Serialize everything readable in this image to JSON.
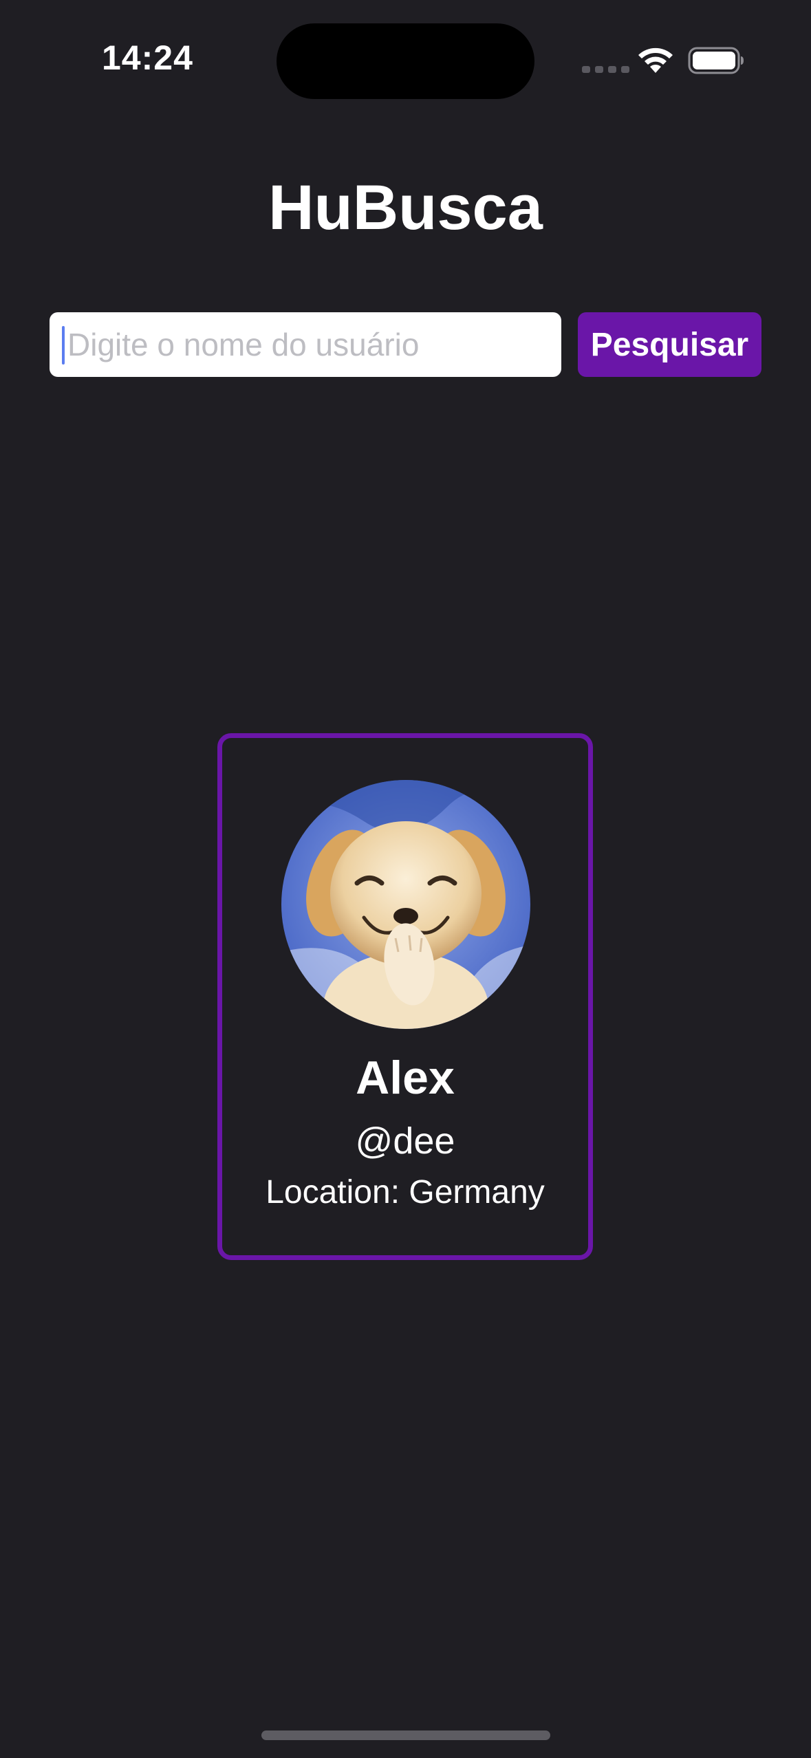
{
  "status_bar": {
    "time": "14:24",
    "icons": [
      "signal-icon",
      "wifi-icon",
      "battery-icon"
    ]
  },
  "app": {
    "title": "HuBusca"
  },
  "search": {
    "placeholder": "Digite o nome do usuário",
    "value": "",
    "button_label": "Pesquisar"
  },
  "user_card": {
    "name": "Alex",
    "login": "@dee",
    "location": "Location: Germany",
    "avatar": "puppy-avatar"
  },
  "colors": {
    "background": "#1f1e23",
    "accent": "#6a16a8",
    "text": "#ffffff"
  }
}
